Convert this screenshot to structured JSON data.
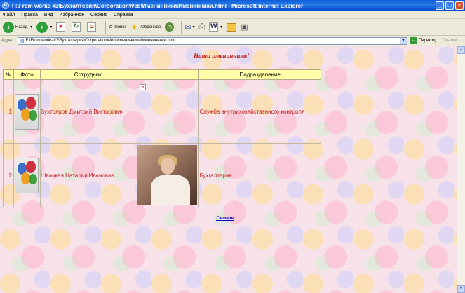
{
  "window": {
    "title": "F:\\From works #3\\Бухгалтерия\\CorporationWeb\\Именинники\\Именинники.html - Microsoft Internet Explorer"
  },
  "menu": [
    "Файл",
    "Правка",
    "Вид",
    "Избранное",
    "Сервис",
    "Справка"
  ],
  "toolbar": {
    "back": "Назад",
    "search": "Поиск",
    "favorites": "Избранное"
  },
  "address": {
    "label": "Адрес:",
    "value": "F:\\From works #3\\Бухгалтерия\\CorporationWeb\\Именинники\\Именинники.html",
    "go": "Переход",
    "links": "Ссылки"
  },
  "page": {
    "heading": "Наши именинники!",
    "columns": [
      "№",
      "Фото",
      "Сотрудник",
      "",
      "Подразделение"
    ],
    "rows": [
      {
        "num": "1",
        "employee": "Бухтояров Дмитрий Викторович",
        "department": "Служба внутрихозяйственного контроля"
      },
      {
        "num": "2",
        "employee": "Швацкая Наталья Ивановна",
        "department": "Бухгалтерия"
      }
    ],
    "link": "Главная"
  },
  "colors": {
    "heading": "#c0201f",
    "header_bg": "#ffffa8",
    "link": "#0000cc"
  }
}
